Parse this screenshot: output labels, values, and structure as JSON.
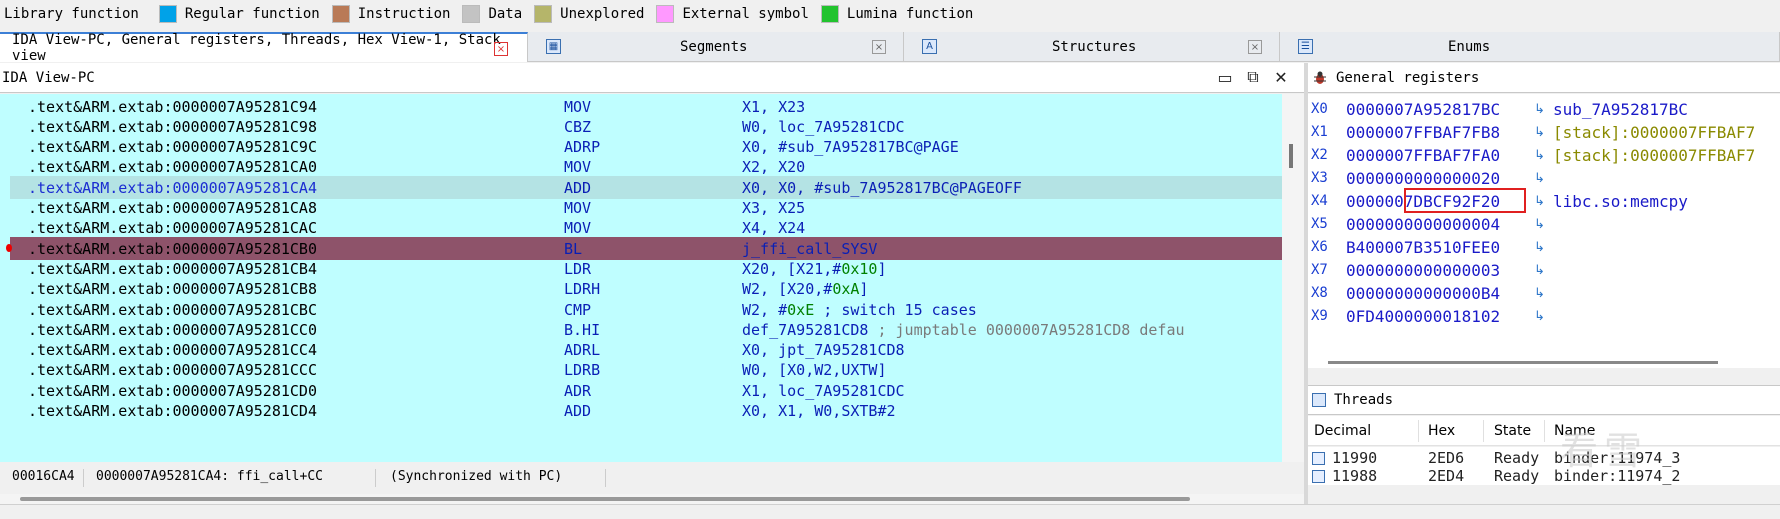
{
  "legend": {
    "items": [
      {
        "label": "Library function",
        "color": "#00a2e8"
      },
      {
        "label": "Regular function",
        "color": "#00a2e8"
      },
      {
        "label": "Instruction",
        "color": "#b97a57"
      },
      {
        "label": "Data",
        "color": "#c3c3c3"
      },
      {
        "label": "Unexplored",
        "color": "#b5b56a"
      },
      {
        "label": "External symbol",
        "color": "#ff99ff"
      },
      {
        "label": "Lumina function",
        "color": "#22c32e"
      }
    ]
  },
  "tabs": [
    {
      "label": "IDA View-PC, General registers, Threads, Hex View-1, Stack view",
      "close": "×",
      "icon": "none"
    },
    {
      "label": "Segments",
      "close": "×",
      "icon": "segments-icon"
    },
    {
      "label": "Structures",
      "close": "×",
      "icon": "structures-icon"
    },
    {
      "label": "Enums",
      "close": "×",
      "icon": "enums-icon"
    }
  ],
  "ida_view": {
    "title": "IDA View-PC",
    "controls": {
      "minimize": "▭",
      "restore": "⧉",
      "close": "✕"
    },
    "lines": [
      {
        "addr": ".text&ARM.extab:0000007A95281C94",
        "mnem": "MOV",
        "ops": [
          {
            "t": "X1, X23"
          }
        ]
      },
      {
        "addr": ".text&ARM.extab:0000007A95281C98",
        "mnem": "CBZ",
        "ops": [
          {
            "t": "W0, loc_7A95281CDC"
          }
        ]
      },
      {
        "addr": ".text&ARM.extab:0000007A95281C9C",
        "mnem": "ADRP",
        "ops": [
          {
            "t": "X0, #sub_7A952817BC@PAGE"
          }
        ]
      },
      {
        "addr": ".text&ARM.extab:0000007A95281CA0",
        "mnem": "MOV",
        "ops": [
          {
            "t": "X2, X20"
          }
        ]
      },
      {
        "addr": ".text&ARM.extab:0000007A95281CA4",
        "mnem": "ADD",
        "ops": [
          {
            "t": "X0, X0, #sub_7A952817BC@PAGEOFF"
          }
        ],
        "style": "hl"
      },
      {
        "addr": ".text&ARM.extab:0000007A95281CA8",
        "mnem": "MOV",
        "ops": [
          {
            "t": "X3, X25"
          }
        ]
      },
      {
        "addr": ".text&ARM.extab:0000007A95281CAC",
        "mnem": "MOV",
        "ops": [
          {
            "t": "X4, X24"
          }
        ]
      },
      {
        "addr": ".text&ARM.extab:0000007A95281CB0",
        "mnem": "BL",
        "ops": [
          {
            "t": "j_ffi_call_SYSV"
          }
        ],
        "style": "bp"
      },
      {
        "addr": ".text&ARM.extab:0000007A95281CB4",
        "mnem": "LDR",
        "ops": [
          {
            "t": "X20, [X21,#"
          },
          {
            "t": "0x10",
            "c": "num"
          },
          {
            "t": "]"
          }
        ]
      },
      {
        "addr": ".text&ARM.extab:0000007A95281CB8",
        "mnem": "LDRH",
        "ops": [
          {
            "t": "W2, [X20,#"
          },
          {
            "t": "0xA",
            "c": "num"
          },
          {
            "t": "]"
          }
        ]
      },
      {
        "addr": ".text&ARM.extab:0000007A95281CBC",
        "mnem": "CMP",
        "ops": [
          {
            "t": "W2, #"
          },
          {
            "t": "0xE",
            "c": "num"
          },
          {
            "t": " ; switch 15 cases"
          }
        ]
      },
      {
        "addr": ".text&ARM.extab:0000007A95281CC0",
        "mnem": "B.HI",
        "ops": [
          {
            "t": "def_7A95281CD8 "
          },
          {
            "t": "; jumptable 0000007A95281CD8 defau",
            "c": "cmt"
          }
        ]
      },
      {
        "addr": ".text&ARM.extab:0000007A95281CC4",
        "mnem": "ADRL",
        "ops": [
          {
            "t": "X0, jpt_7A95281CD8"
          }
        ]
      },
      {
        "addr": ".text&ARM.extab:0000007A95281CCC",
        "mnem": "LDRB",
        "ops": [
          {
            "t": "W0, [X0,W2,UXTW]"
          }
        ]
      },
      {
        "addr": ".text&ARM.extab:0000007A95281CD0",
        "mnem": "ADR",
        "ops": [
          {
            "t": "X1, loc_7A95281CDC"
          }
        ]
      },
      {
        "addr": ".text&ARM.extab:0000007A95281CD4",
        "mnem": "ADD",
        "ops": [
          {
            "t": "X0, X1, W0,SXTB#2"
          }
        ]
      }
    ],
    "status": {
      "offset": "00016CA4",
      "location": "0000007A95281CA4: ffi_call+CC",
      "sync": "(Synchronized with PC)"
    }
  },
  "registers": {
    "title": "General registers",
    "arrow": "↳",
    "rows": [
      {
        "name": "X0",
        "value": "0000007A952817BC",
        "ref": "sub_7A952817BC",
        "refType": "ref-code"
      },
      {
        "name": "X1",
        "value": "0000007FFBAF7FB8",
        "ref": "[stack]:0000007FFBAF7",
        "refType": "ref-stack"
      },
      {
        "name": "X2",
        "value": "0000007FFBAF7FA0",
        "ref": "[stack]:0000007FFBAF7",
        "refType": "ref-stack"
      },
      {
        "name": "X3",
        "value": "0000000000000020",
        "ref": "",
        "refType": "ref-code"
      },
      {
        "name": "X4",
        "value": "0000007DBCF92F20",
        "ref": "libc.so:memcpy",
        "refType": "ref-lib",
        "boxed": true
      },
      {
        "name": "X5",
        "value": "0000000000000004",
        "ref": "",
        "refType": "ref-code"
      },
      {
        "name": "X6",
        "value": "B400007B3510FEE0",
        "ref": "",
        "refType": "ref-code"
      },
      {
        "name": "X7",
        "value": "0000000000000003",
        "ref": "",
        "refType": "ref-code"
      },
      {
        "name": "X8",
        "value": "00000000000000B4",
        "ref": "",
        "refType": "ref-code"
      },
      {
        "name": "X9",
        "value": "0FD4000000018102",
        "ref": "",
        "refType": "ref-code"
      }
    ]
  },
  "threads": {
    "title": "Threads",
    "columns": [
      "Decimal",
      "Hex",
      "State",
      "Name"
    ],
    "rows": [
      {
        "decimal": "11990",
        "hex": "2ED6",
        "state": "Ready",
        "name": "binder:11974_3"
      },
      {
        "decimal": "11988",
        "hex": "2ED4",
        "state": "Ready",
        "name": "binder:11974_2"
      }
    ]
  },
  "watermark": "看雪"
}
